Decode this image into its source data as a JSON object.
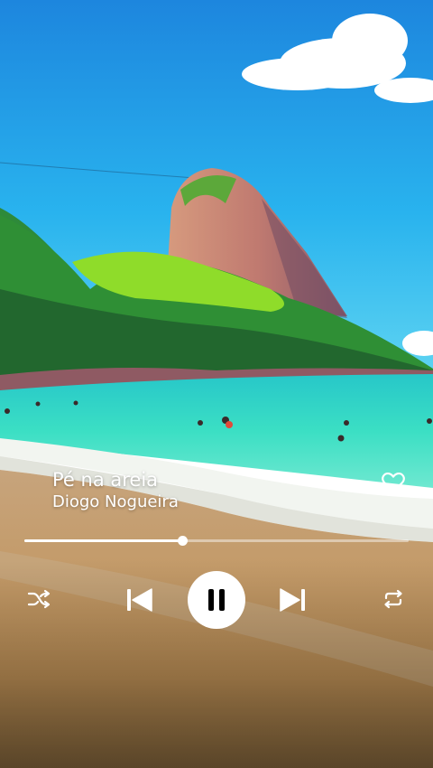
{
  "track": {
    "title": "Pé na areia",
    "artist": "Diogo Nogueira"
  },
  "playback": {
    "progress": 0.41,
    "state": "playing"
  },
  "icons": {
    "favorite": "heart-outline-icon",
    "shuffle": "shuffle-icon",
    "previous": "skip-previous-icon",
    "play_pause": "pause-icon",
    "next": "skip-next-icon",
    "repeat": "repeat-icon"
  },
  "colors": {
    "controls": "#ffffff",
    "sky_top": "#1f8fe0",
    "sea": "#37d9c0",
    "sand": "#c9a06a"
  }
}
